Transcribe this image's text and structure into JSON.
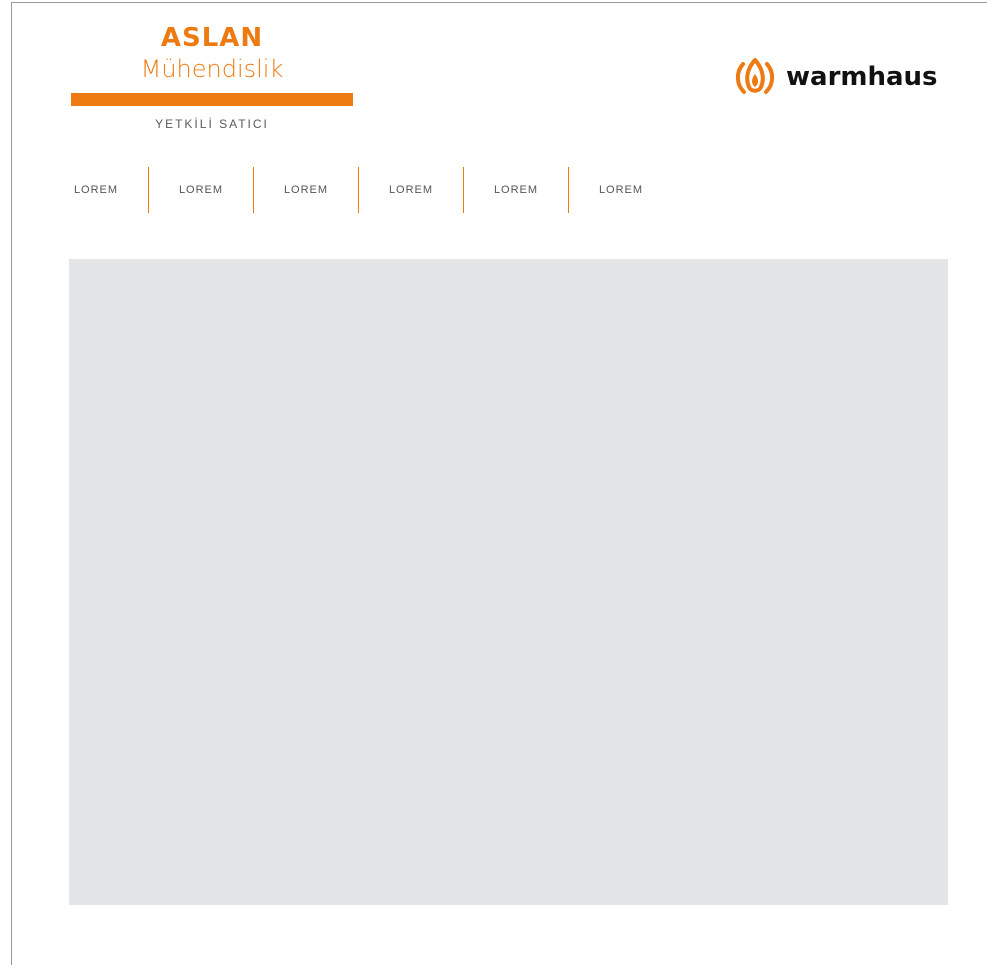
{
  "brand": {
    "title": "ASLAN",
    "subtitle": "Mühendislik",
    "tagline": "YETKİLİ SATICI",
    "accent_color": "#ee7a12"
  },
  "partner": {
    "name": "warmhaus",
    "icon": "flame-logo-icon"
  },
  "nav": {
    "items": [
      {
        "label": "LOREM"
      },
      {
        "label": "LOREM"
      },
      {
        "label": "LOREM"
      },
      {
        "label": "LOREM"
      },
      {
        "label": "LOREM"
      },
      {
        "label": "LOREM"
      }
    ]
  },
  "hero": {
    "background_color": "#e4e5e7"
  }
}
